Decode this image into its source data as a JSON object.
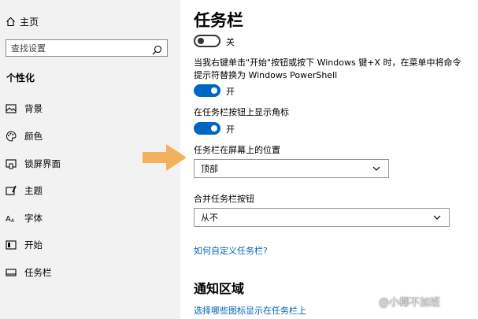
{
  "sidebar": {
    "home_label": "主页",
    "search_placeholder": "查找设置",
    "section_title": "个性化",
    "items": [
      {
        "label": "背景",
        "icon": "image-icon"
      },
      {
        "label": "颜色",
        "icon": "palette-icon"
      },
      {
        "label": "锁屏界面",
        "icon": "lock-screen-icon"
      },
      {
        "label": "主题",
        "icon": "theme-brush-icon"
      },
      {
        "label": "字体",
        "icon": "font-icon"
      },
      {
        "label": "开始",
        "icon": "start-icon"
      },
      {
        "label": "任务栏",
        "icon": "taskbar-icon"
      }
    ]
  },
  "main": {
    "title": "任务栏",
    "toggle1_state": "关",
    "setting_powershell": "当我右键单击\"开始\"按钮或按下 Windows 键+X 时，在菜单中将命令提示符替换为 Windows PowerShell",
    "toggle2_state": "开",
    "setting_badges": "在任务栏按钮上显示角标",
    "toggle3_state": "开",
    "position_label": "任务栏在屏幕上的位置",
    "position_value": "顶部",
    "combine_label": "合并任务栏按钮",
    "combine_value": "从不",
    "customize_link": "如何自定义任务栏?",
    "notification_heading": "通知区域",
    "notification_link": "选择哪些图标显示在任务栏上"
  },
  "watermark": "@小椰不加班",
  "colors": {
    "accent": "#0067c0",
    "link": "#0066b4",
    "arrow": "#f2b25c",
    "sidebar_bg": "#f2f2f2"
  }
}
